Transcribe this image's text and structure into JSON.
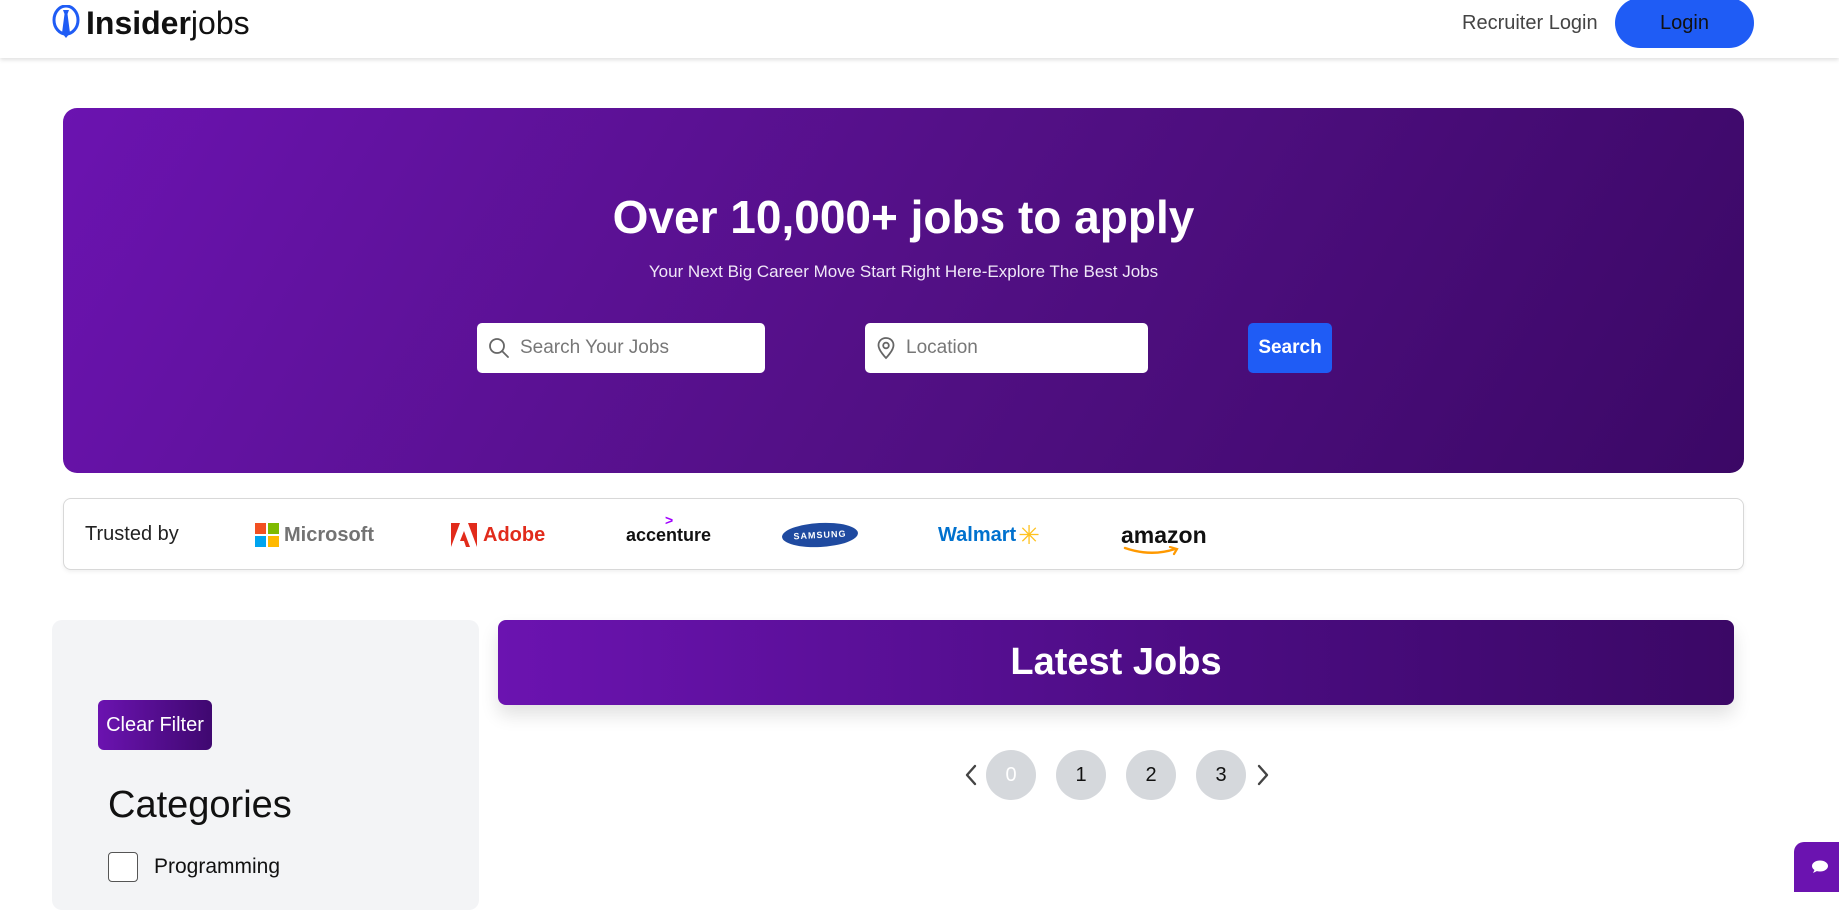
{
  "header": {
    "logo_bold": "Insider",
    "logo_light": "jobs",
    "recruiter_login": "Recruiter Login",
    "login": "Login"
  },
  "hero": {
    "title": "Over 10,000+ jobs to apply",
    "subtitle": "Your Next Big Career Move Start Right Here-Explore The Best Jobs",
    "search_placeholder": "Search Your Jobs",
    "location_placeholder": "Location",
    "search_button": "Search"
  },
  "trusted": {
    "label": "Trusted by",
    "brands": {
      "microsoft": "Microsoft",
      "adobe": "Adobe",
      "accenture": "accenture",
      "samsung": "SAMSUNG",
      "walmart": "Walmart",
      "amazon": "amazon"
    }
  },
  "sidebar": {
    "clear_filter": "Clear Filter",
    "categories_title": "Categories",
    "categories": [
      "Programming"
    ]
  },
  "latest_jobs": {
    "title": "Latest Jobs"
  },
  "pagination": {
    "pages": [
      "0",
      "1",
      "2",
      "3"
    ],
    "current": "0"
  },
  "colors": {
    "primary_blue": "#1f5cf5",
    "hero_purple_start": "#6b13b0",
    "hero_purple_end": "#3b0866"
  }
}
